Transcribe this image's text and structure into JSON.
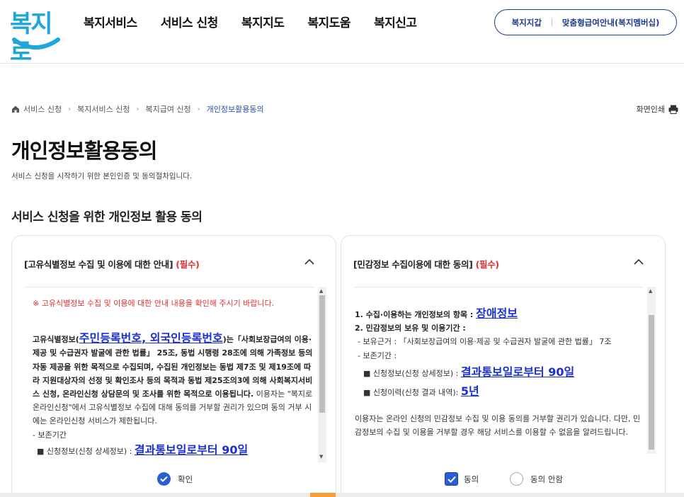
{
  "logo": {
    "text": "복지로"
  },
  "nav": {
    "items": [
      "복지서비스",
      "서비스 신청",
      "복지지도",
      "복지도움",
      "복지신고"
    ]
  },
  "top_links": {
    "wallet": "복지지갑",
    "membership": "맞춤형급여안내(복지멤버십)"
  },
  "breadcrumb": {
    "items": [
      "서비스 신청",
      "복지서비스 신청",
      "복지급여 신청"
    ],
    "current": "개인정보활용동의"
  },
  "print_label": "화면인쇄",
  "page": {
    "title": "개인정보활용동의",
    "description": "서비스 신청을 시작하기 위한 본인인증 및 동의절차입니다.",
    "section_title": "서비스 신청을 위한 개인정보 활용 동의"
  },
  "left_card": {
    "heading": "[고유식별정보 수집 및 이용에 대한 안내]",
    "required": "(필수)",
    "warning": "※ 고유식별정보 수집 및 이용에 대한 안내 내용을 확인해 주시기 바랍니다.",
    "body_prefix": "고유식별정보(",
    "body_link": "주민등록번호, 외국인등록번호",
    "body_main": ")는「사회보장급여의 이용·제공 및 수급권자 발굴에 관한 법률」 25조, 동법 시행령 28조에 의해 가족정보 등의 자동 제공을 위한 목적으로 수집되며, 수집된 개인정보는 동법 제7조 및 제19조에 따라 지원대상자의 선정 및 확인조사 등의 목적과 동법 제25조의3에 의해 사회복지서비스 신청, 온라인신청 상담문의 및 조사를 위한 목적으로 이용됩니다.",
    "body_tail": " 이용자는 \"복지로 온라인신청\"에서 고유식별정보 수집에 대해 동의를 거부할 권리가 있으며 동의 거부 시에는 온라인신청 서비스가 제한됩니다.",
    "retention_label": "- 보존기간",
    "retention_item_label": "■ 신청정보(신청 상세정보) : ",
    "retention_item_value": "결과통보일로부터 90일",
    "confirm_label": "확인"
  },
  "right_card": {
    "heading": "[민감정보 수집이용에 대한 동의]",
    "required": "(필수)",
    "item1_label": "1. 수집·이용하는 개인정보의 항목 : ",
    "item1_value": "장애정보",
    "item2_label": "2. 민감정보의 보유 및 이용기간 :",
    "basis": "- 보유근거 : 「사회보장급여의 이용·제공 및 수급권자 발굴에 관한 법률」 7조",
    "retention": "- 보존기간 :",
    "ret1_label": "■ 신청정보(신청 상세정보) : ",
    "ret1_value": "결과통보일로부터 90일",
    "ret2_label": "■ 신청이력(신청 결과 내역): ",
    "ret2_value": "5년",
    "notice": "이용자는 온라인 신청의 민감정보 수집 및 이용 동의를 거부할 권리가 있습니다. 다만, 민감정보의 수집 및 이용을 거부할 경우 해당 서비스를 이용할 수 없음을 알려드립니다.",
    "agree_label": "동의",
    "disagree_label": "동의 안함"
  },
  "colors": {
    "brand": "#1ea6d9",
    "navy": "#1d3b8f",
    "required": "#e0312f",
    "link": "#1a2fd6",
    "check": "#2a5fd1"
  }
}
